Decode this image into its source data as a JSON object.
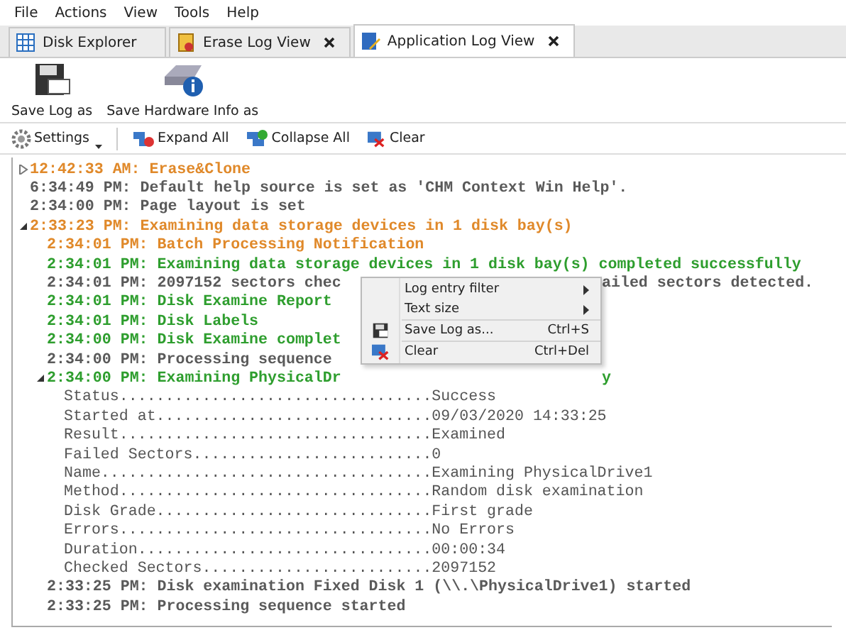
{
  "menu_bar": [
    "File",
    "Actions",
    "View",
    "Tools",
    "Help"
  ],
  "tabs": [
    {
      "label": "Disk Explorer",
      "closable": false,
      "selected": false
    },
    {
      "label": "Erase Log View",
      "closable": true,
      "selected": false
    },
    {
      "label": "Application Log View",
      "closable": true,
      "selected": true
    }
  ],
  "ribbon": [
    {
      "label": "Save Log as"
    },
    {
      "label": "Save Hardware Info as"
    }
  ],
  "toolbar": [
    {
      "label": "Settings",
      "dropdown": true
    },
    {
      "label": "Expand All",
      "dropdown": false
    },
    {
      "label": "Collapse All",
      "dropdown": false
    },
    {
      "label": "Clear",
      "dropdown": false
    }
  ],
  "log": [
    {
      "kind": "entry",
      "text": "12:42:33 AM: Erase&Clone",
      "color": "#e0892a",
      "expanded": false
    },
    {
      "kind": "entry",
      "text": "6:34:49 PM: Default help source is set as 'CHM Context Win Help'.",
      "color": "#5a5a5a"
    },
    {
      "kind": "entry",
      "text": "2:34:00 PM: Page layout is set",
      "color": "#5a5a5a"
    },
    {
      "kind": "entry",
      "text": "2:33:23 PM: Examining data storage devices in 1 disk bay(s)",
      "color": "#e0892a",
      "expanded": true,
      "children": [
        {
          "kind": "entry",
          "text": "2:34:01 PM: Batch Processing Notification",
          "color": "#e0892a"
        },
        {
          "kind": "entry",
          "text": "2:34:01 PM: Examining data storage devices in 1 disk bay(s) completed successfully",
          "color": "#2e9e2e"
        },
        {
          "kind": "entry",
          "text": "2:34:01 PM: 2097152 sectors chec",
          "tail": "ailed sectors detected.",
          "color": "#5a5a5a"
        },
        {
          "kind": "entry",
          "text": "2:34:01 PM: Disk Examine Report",
          "color": "#2e9e2e"
        },
        {
          "kind": "entry",
          "text": "2:34:01 PM: Disk Labels",
          "color": "#2e9e2e"
        },
        {
          "kind": "entry",
          "text": "2:34:00 PM: Disk Examine complet",
          "color": "#2e9e2e"
        },
        {
          "kind": "entry",
          "text": "2:34:00 PM: Processing sequence",
          "color": "#5a5a5a"
        },
        {
          "kind": "entry",
          "text": "2:34:00 PM: Examining PhysicalDr",
          "tail": "y",
          "color": "#2e9e2e",
          "expanded": true,
          "children": [
            {
              "kind": "field",
              "label": "Status..................................",
              "value": "Success"
            },
            {
              "kind": "field",
              "label": "Started at..............................",
              "value": "09/03/2020 14:33:25"
            },
            {
              "kind": "field",
              "label": "Result..................................",
              "value": "Examined"
            },
            {
              "kind": "field",
              "label": "Failed Sectors..........................",
              "value": "0"
            },
            {
              "kind": "field",
              "label": "Name....................................",
              "value": "Examining PhysicalDrive1"
            },
            {
              "kind": "field",
              "label": "Method..................................",
              "value": "Random disk examination"
            },
            {
              "kind": "field",
              "label": "Disk Grade..............................",
              "value": "First grade"
            },
            {
              "kind": "field",
              "label": "Errors..................................",
              "value": "No Errors"
            },
            {
              "kind": "field",
              "label": "Duration................................",
              "value": "00:00:34"
            },
            {
              "kind": "field",
              "label": "Checked Sectors.........................",
              "value": "2097152"
            }
          ]
        },
        {
          "kind": "entry",
          "text": "2:33:25 PM: Disk examination Fixed Disk 1 (\\\\.\\PhysicalDrive1) started",
          "color": "#5a5a5a"
        },
        {
          "kind": "entry",
          "text": "2:33:25 PM: Processing sequence started",
          "color": "#5a5a5a"
        }
      ]
    }
  ],
  "context_menu": [
    {
      "kind": "submenu",
      "label": "Log entry filter"
    },
    {
      "kind": "submenu",
      "label": "Text size"
    },
    {
      "kind": "separator"
    },
    {
      "kind": "command",
      "label": "Save Log as...",
      "shortcut": "Ctrl+S"
    },
    {
      "kind": "separator"
    },
    {
      "kind": "command",
      "label": "Clear",
      "shortcut": "Ctrl+Del"
    }
  ]
}
